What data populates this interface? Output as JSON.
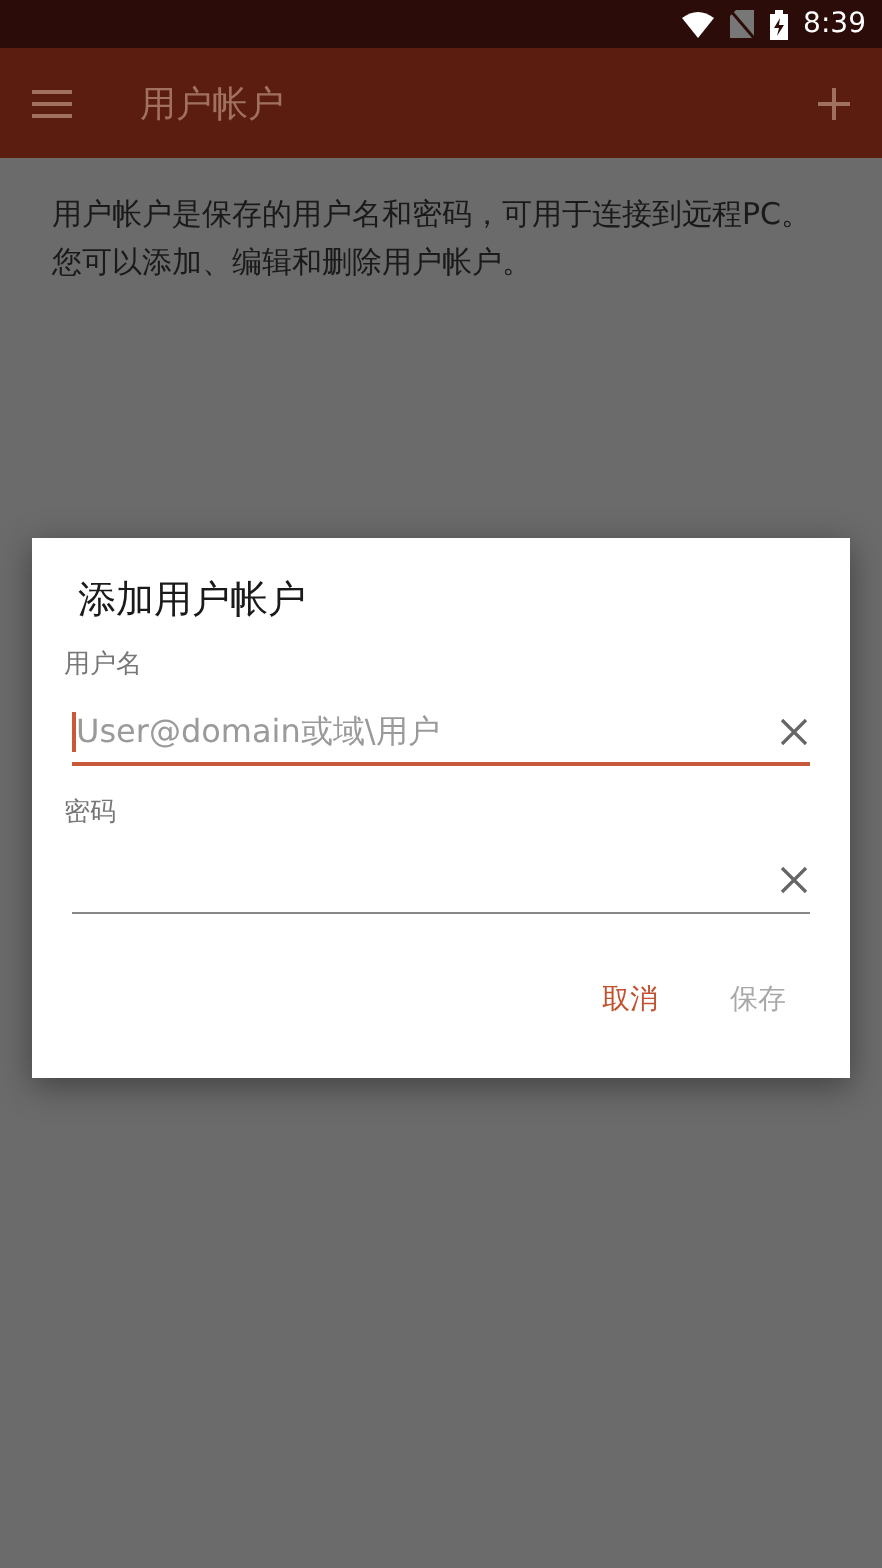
{
  "status_bar": {
    "time": "8:39"
  },
  "app_bar": {
    "title": "用户帐户"
  },
  "description": "用户帐户是保存的用户名和密码，可用于连接到远程PC。您可以添加、编辑和删除用户帐户。",
  "dialog": {
    "title": "添加用户帐户",
    "fields": [
      {
        "label": "用户名",
        "placeholder": "User@domain或域\\用户",
        "focused": true
      },
      {
        "label": "密码",
        "focused": false
      }
    ],
    "buttons": [
      {
        "label": "取消",
        "disabled": false
      },
      {
        "label": "保存",
        "disabled": true
      }
    ]
  }
}
